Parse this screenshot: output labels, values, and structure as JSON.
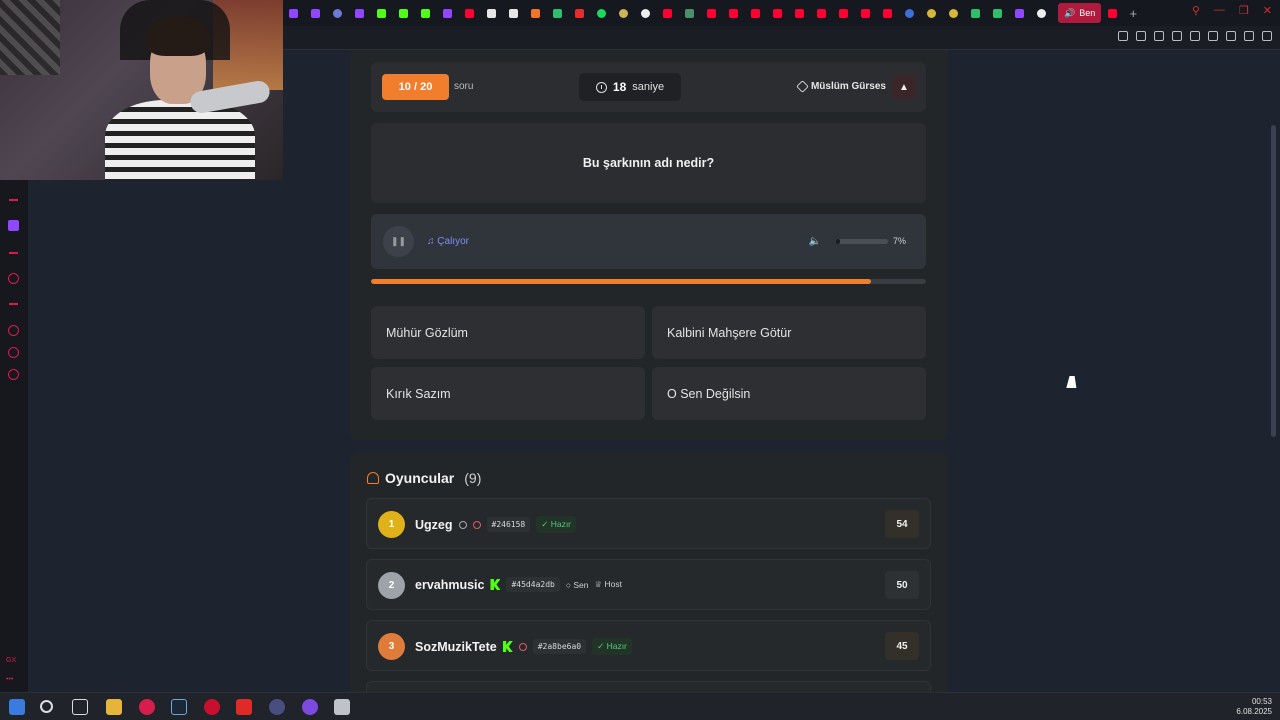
{
  "game": {
    "question_counter": "10 / 20",
    "question_unit": "soru",
    "timer_value": "18",
    "timer_unit": "saniye",
    "artist": "Müslüm Gürses",
    "question": "Bu şarkının adı nedir?",
    "player_status": "Çalıyor",
    "volume_label": "7%",
    "volume_level": 0.07,
    "progress_fraction": 0.9,
    "answers": [
      "Mühür Gözlüm",
      "Kalbini Mahşere Götür",
      "Kırık Sazım",
      "O Sen Değilsin"
    ]
  },
  "players": {
    "title": "Oyuncular",
    "count": "(9)",
    "rows": [
      {
        "rank": "1",
        "name": "Ugzeg",
        "tag": "#246158",
        "status": "Hazır",
        "score": "54"
      },
      {
        "rank": "2",
        "name": "ervahmusic",
        "tag": "#45d4a2db",
        "you": "Sen",
        "host": "Host",
        "score": "50"
      },
      {
        "rank": "3",
        "name": "SozMuzikTete",
        "tag": "#2a8be6a0",
        "status": "Hazır",
        "score": "45"
      }
    ]
  },
  "browser": {
    "active_tab_label": "Ben"
  },
  "taskbar": {
    "time": "00:53",
    "date": "6.08.2025"
  },
  "sidebar": {
    "bottom_label": "GX"
  },
  "colors": {
    "accent": "#f07e2c",
    "rank1": "#e0b21a",
    "rank2": "#9ea3aa",
    "rank3": "#e07c3a",
    "brand_red": "#d61d4c"
  }
}
